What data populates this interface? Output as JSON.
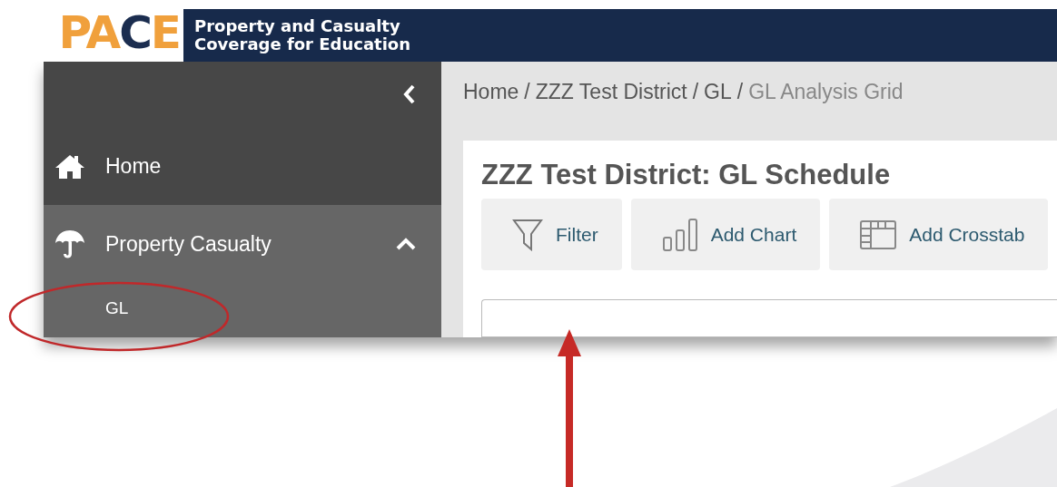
{
  "logo": {
    "parts": [
      {
        "text": "PA",
        "accent": false
      },
      {
        "text": "C",
        "accent": true
      },
      {
        "text": "E",
        "accent": false
      }
    ],
    "tagline": [
      "Property and Casualty",
      "Coverage for Education"
    ]
  },
  "sidebar": {
    "items": [
      {
        "label": "Home",
        "kind": "home",
        "expanded": false
      },
      {
        "label": "Property Casualty",
        "kind": "umbrella",
        "expanded": true,
        "children": [
          {
            "label": "GL"
          }
        ]
      }
    ]
  },
  "breadcrumb": [
    {
      "text": "Home",
      "kind": "link"
    },
    {
      "text": "/",
      "kind": "separator"
    },
    {
      "text": "ZZZ Test District",
      "kind": "link"
    },
    {
      "text": "/",
      "kind": "separator"
    },
    {
      "text": "GL",
      "kind": "link"
    },
    {
      "text": "/",
      "kind": "separator"
    },
    {
      "text": "GL Analysis Grid",
      "kind": "current"
    }
  ],
  "page_title": "ZZZ Test District: GL Schedule",
  "toolbar": [
    {
      "label": "Filter",
      "kind": "filter"
    },
    {
      "label": "Add Chart",
      "kind": "chart"
    },
    {
      "label": "Add Crosstab",
      "kind": "crosstab"
    }
  ]
}
